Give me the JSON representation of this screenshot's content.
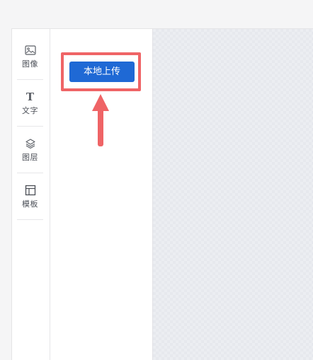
{
  "toolbar": {
    "items": [
      {
        "label": "图像",
        "icon": "image-icon"
      },
      {
        "label": "文字",
        "icon": "text-icon",
        "glyph": "T"
      },
      {
        "label": "图层",
        "icon": "layers-icon"
      },
      {
        "label": "模板",
        "icon": "template-icon"
      }
    ]
  },
  "panel": {
    "upload_label": "本地上传"
  },
  "colors": {
    "accent": "#1f69d5",
    "highlight": "#ef6466"
  }
}
